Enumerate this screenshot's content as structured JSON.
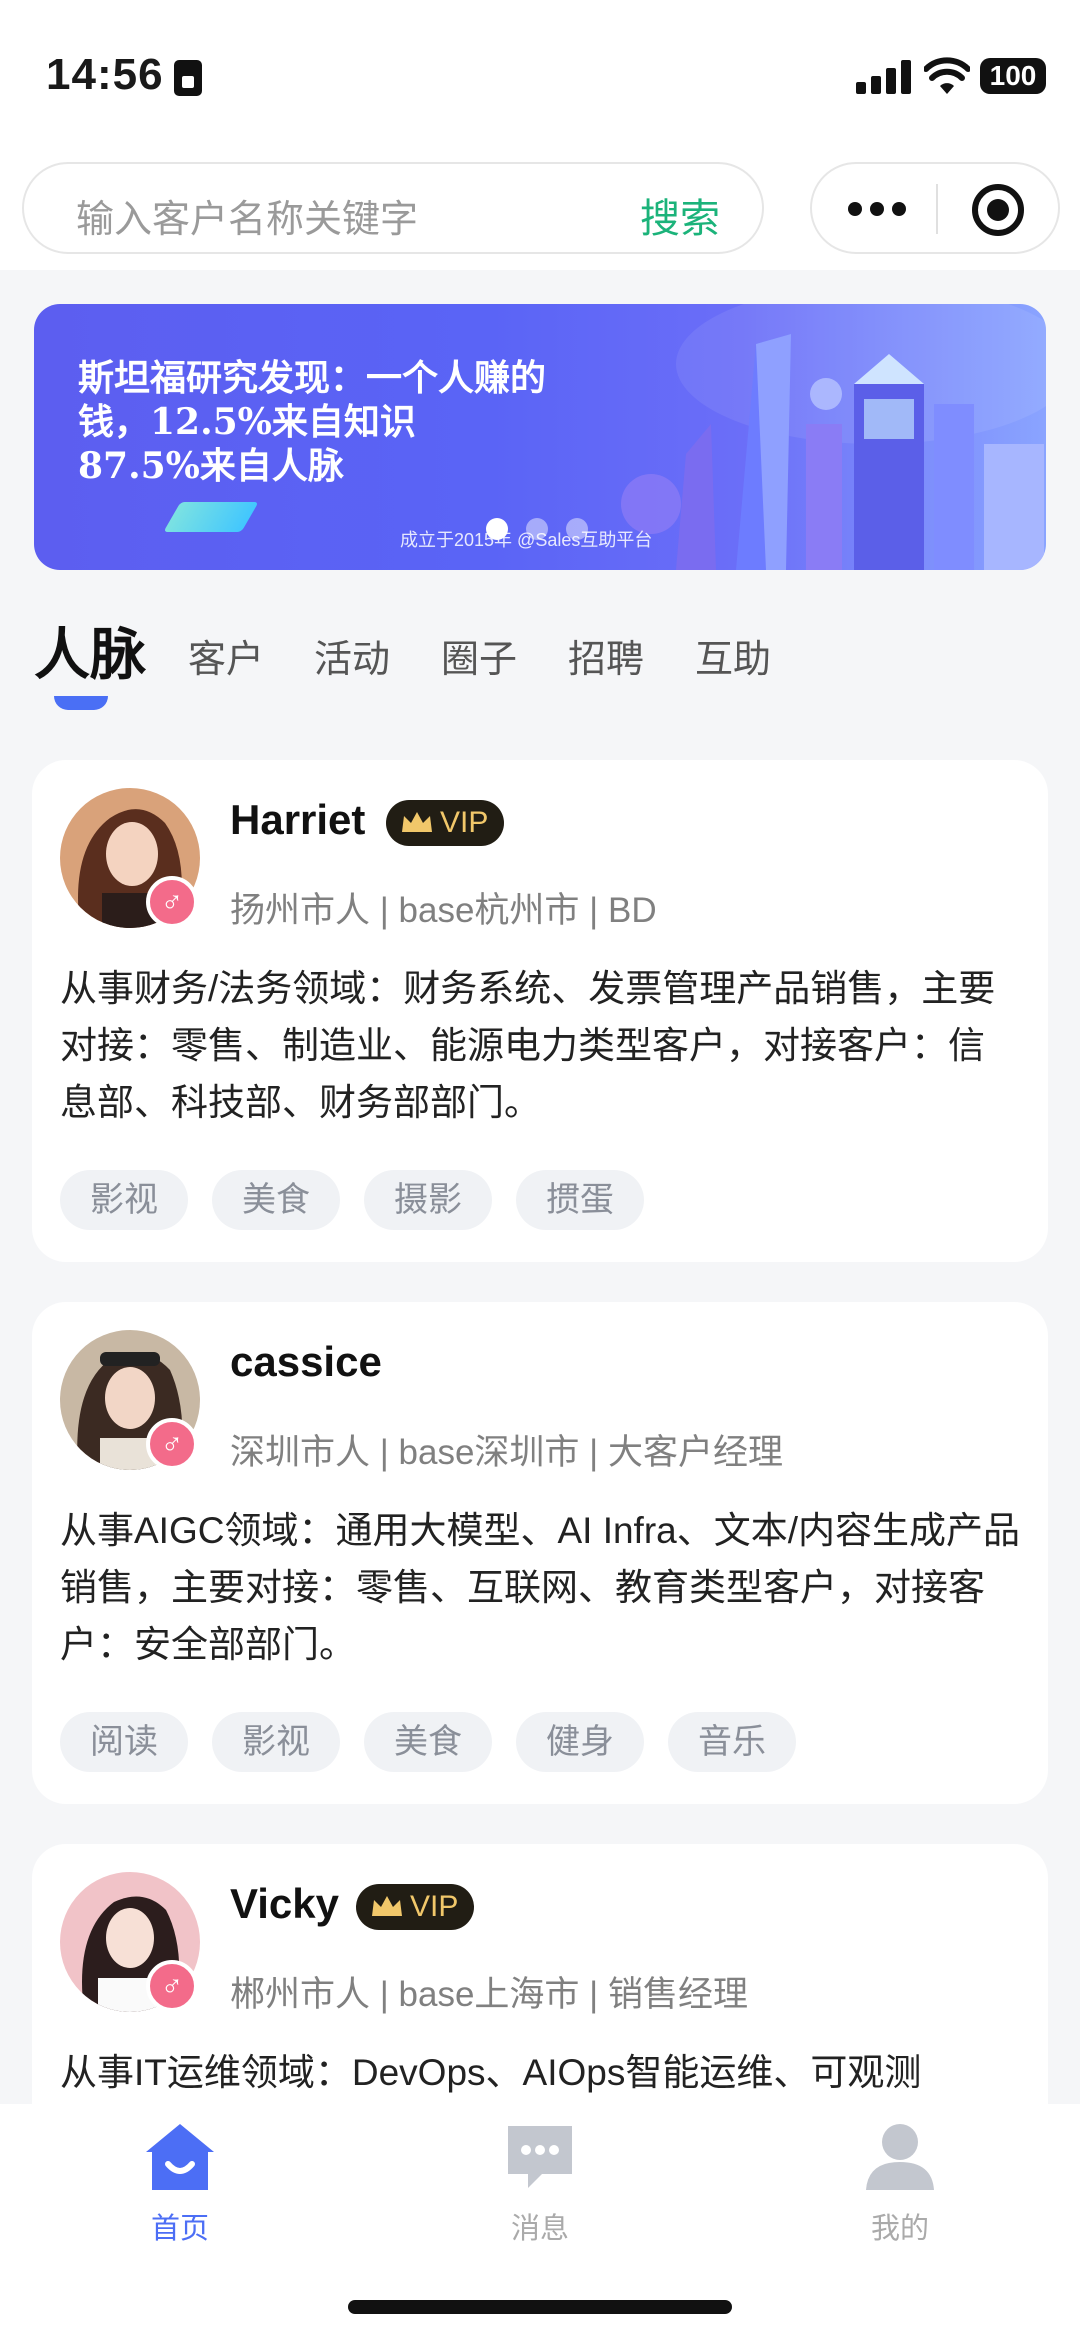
{
  "status_bar": {
    "time": "14:56",
    "battery": "100"
  },
  "search": {
    "placeholder": "输入客户名称关键字",
    "button": "搜索"
  },
  "banner": {
    "headline": "斯坦福研究发现：一个人赚的\n钱，12.5%来自知识\n87.5%来自人脉",
    "footnote": "成立于2015年 @Sales互助平台",
    "slide_count": 3,
    "active_slide": 0
  },
  "tabs": [
    {
      "label": "人脉",
      "active": true
    },
    {
      "label": "客户"
    },
    {
      "label": "活动"
    },
    {
      "label": "圈子"
    },
    {
      "label": "招聘"
    },
    {
      "label": "互助"
    }
  ],
  "cards": [
    {
      "name": "Harriet",
      "vip": "VIP",
      "gender": "♂",
      "meta": "扬州市人 | base杭州市 | BD",
      "description": "从事财务/法务领域：财务系统、发票管理产品销售，主要对接：零售、制造业、能源电力类型客户，对接客户：信息部、科技部、财务部部门。",
      "tags": [
        "影视",
        "美食",
        "摄影",
        "掼蛋"
      ]
    },
    {
      "name": "cassice",
      "vip": "",
      "gender": "♂",
      "meta": "深圳市人 | base深圳市 | 大客户经理",
      "description": "从事AIGC领域：通用大模型、AI Infra、文本/内容生成产品销售，主要对接：零售、互联网、教育类型客户，对接客户：安全部部门。",
      "tags": [
        "阅读",
        "影视",
        "美食",
        "健身",
        "音乐"
      ]
    },
    {
      "name": "Vicky",
      "vip": "VIP",
      "gender": "♂",
      "meta": "郴州市人 | base上海市 | 销售经理",
      "description": "从事IT运维领域：DevOps、AIOps智能运维、可观测",
      "tags": []
    }
  ],
  "bottom_nav": [
    {
      "label": "首页",
      "icon": "home-icon",
      "active": true
    },
    {
      "label": "消息",
      "icon": "message-icon"
    },
    {
      "label": "我的",
      "icon": "profile-icon"
    }
  ],
  "colors": {
    "accent": "#4c6ef5",
    "search_button": "#1bb37a",
    "vip_bg": "#211d14",
    "vip_text": "#f1c76a",
    "gender_badge": "#f36b8a"
  }
}
